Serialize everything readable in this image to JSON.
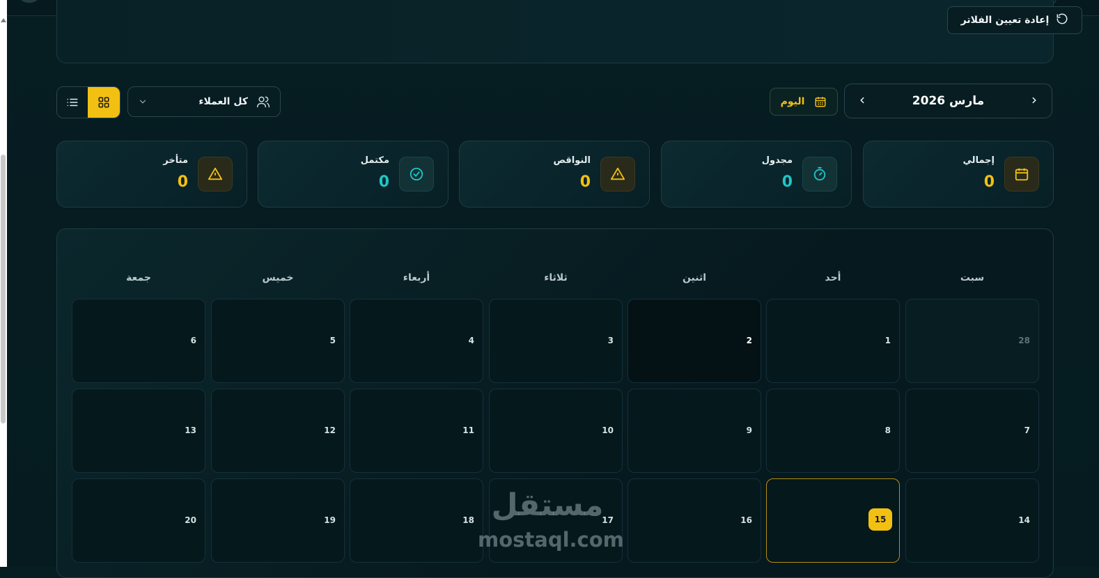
{
  "filters": {
    "reset_label": "إعادة تعيين الفلاتر"
  },
  "toolbar": {
    "client_select_value": "كل العملاء",
    "today_label": "اليوم",
    "month_title": "مارس 2026"
  },
  "stats": [
    {
      "label": "إجمالي",
      "value": "0",
      "icon": "calendar-icon",
      "color": "#f2c012"
    },
    {
      "label": "مجدول",
      "value": "0",
      "icon": "timer-icon",
      "color": "#1ec6c6"
    },
    {
      "label": "النواقص",
      "value": "0",
      "icon": "warning-icon",
      "color": "#f2c012"
    },
    {
      "label": "مكتمل",
      "value": "0",
      "icon": "check-circle-icon",
      "color": "#1ec6c6"
    },
    {
      "label": "متأخر",
      "value": "0",
      "icon": "warning-icon",
      "color": "#f2c012"
    }
  ],
  "calendar": {
    "weekdays": [
      "سبت",
      "أحد",
      "اثنين",
      "ثلاثاء",
      "أربعاء",
      "خميس",
      "جمعة"
    ],
    "weeks": [
      [
        "28",
        "1",
        "2",
        "3",
        "4",
        "5",
        "6"
      ],
      [
        "7",
        "8",
        "9",
        "10",
        "11",
        "12",
        "13"
      ],
      [
        "14",
        "15",
        "16",
        "17",
        "18",
        "19",
        "20"
      ]
    ],
    "today": "15"
  },
  "watermark": {
    "arabic": "مستقل",
    "latin": "mostaql.com"
  },
  "colors": {
    "accent": "#f2c012",
    "teal": "#1ec6c6",
    "background": "#061d22"
  }
}
